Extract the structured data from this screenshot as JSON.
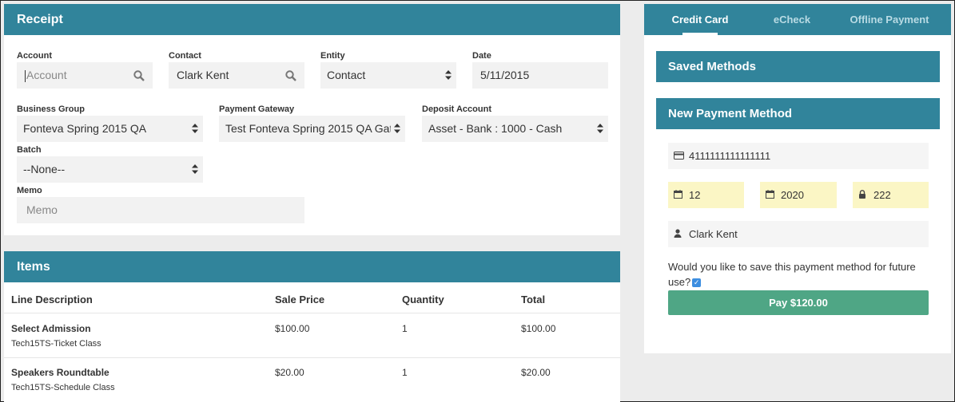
{
  "receipt": {
    "title": "Receipt",
    "account": {
      "label": "Account",
      "placeholder": "Account"
    },
    "contact": {
      "label": "Contact",
      "value": "Clark Kent"
    },
    "entity": {
      "label": "Entity",
      "value": "Contact"
    },
    "date": {
      "label": "Date",
      "value": "5/11/2015"
    },
    "business_group": {
      "label": "Business Group",
      "value": "Fonteva Spring 2015 QA"
    },
    "payment_gateway": {
      "label": "Payment Gateway",
      "value": "Test Fonteva Spring 2015 QA Gate"
    },
    "deposit_account": {
      "label": "Deposit Account",
      "value": "Asset - Bank : 1000 - Cash"
    },
    "batch": {
      "label": "Batch",
      "value": "--None--"
    },
    "memo": {
      "label": "Memo",
      "placeholder": "Memo"
    }
  },
  "items": {
    "title": "Items",
    "columns": [
      "Line Description",
      "Sale Price",
      "Quantity",
      "Total"
    ],
    "rows": [
      {
        "name": "Select Admission",
        "sub": "Tech15TS-Ticket Class",
        "price": "$100.00",
        "qty": "1",
        "total": "$100.00"
      },
      {
        "name": "Speakers Roundtable",
        "sub": "Tech15TS-Schedule Class",
        "price": "$20.00",
        "qty": "1",
        "total": "$20.00"
      }
    ]
  },
  "payment": {
    "tabs": [
      "Credit Card",
      "eCheck",
      "Offline Payment"
    ],
    "active_tab": "Credit Card",
    "saved_methods": "Saved Methods",
    "new_method": "New Payment Method",
    "card_number": "4111111111111111",
    "exp_month": "12",
    "exp_year": "2020",
    "cvv": "222",
    "name_on_card": "Clark Kent",
    "save_question": "Would you like to save this payment method for future use?",
    "save_checked": true,
    "pay_button": "Pay $120.00"
  },
  "icons": {
    "search": "search-icon",
    "select_arrows": "select-arrows-icon",
    "credit_card": "credit-card-icon",
    "calendar": "calendar-icon",
    "lock": "lock-icon",
    "user": "user-icon",
    "checkbox": "checkbox-icon"
  },
  "colors": {
    "header_teal": "#31849b",
    "pay_green": "#4fa685",
    "field_yellow": "#fbf6c5",
    "checkbox_blue": "#3d8ee0"
  }
}
